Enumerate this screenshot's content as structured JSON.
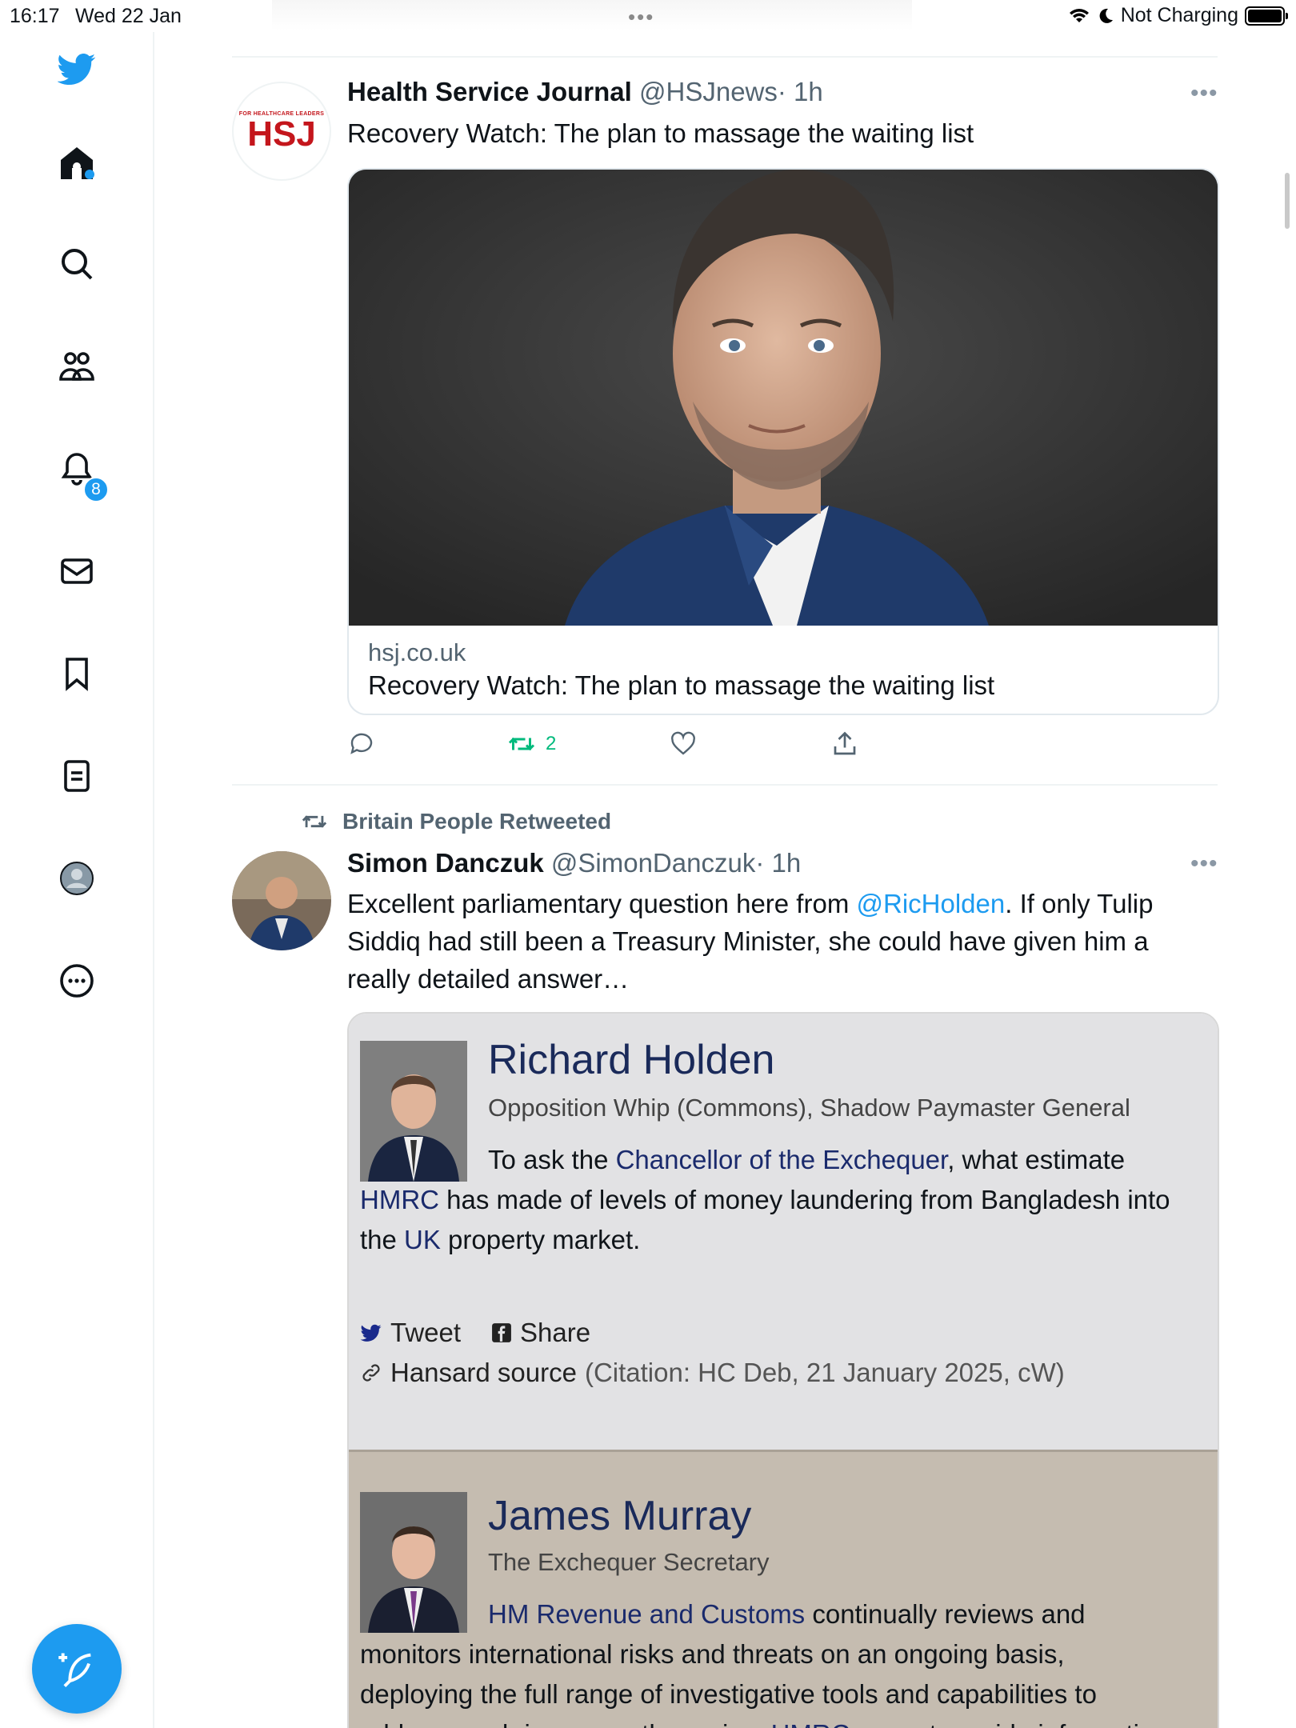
{
  "status_bar": {
    "time": "16:17",
    "date": "Wed 22 Jan",
    "battery_text": "Not Charging",
    "multitask_dots": "•••"
  },
  "sidebar": {
    "notifications_badge": "8",
    "items": [
      {
        "icon": "twitter-bird-icon"
      },
      {
        "icon": "home-icon"
      },
      {
        "icon": "search-icon"
      },
      {
        "icon": "communities-icon"
      },
      {
        "icon": "notifications-bell-icon"
      },
      {
        "icon": "messages-envelope-icon"
      },
      {
        "icon": "bookmark-icon"
      },
      {
        "icon": "lists-icon"
      },
      {
        "icon": "profile-avatar-icon"
      },
      {
        "icon": "more-options-icon"
      }
    ]
  },
  "tweet1": {
    "avatar_small": "FOR HEALTHCARE LEADERS",
    "avatar_logo": "HSJ",
    "name": "Health Service Journal",
    "handle": "@HSJnews",
    "time": "· 1h",
    "text": "Recovery Watch: The plan to massage the waiting list",
    "card_domain": "hsj.co.uk",
    "card_title": "Recovery Watch: The plan to massage the waiting list",
    "retweet_count": "2",
    "more": "•••"
  },
  "tweet2": {
    "retweeted_by": "Britain People Retweeted",
    "name": "Simon Danczuk",
    "handle": "@SimonDanczuk",
    "time": "· 1h",
    "text_part1": "Excellent parliamentary question here from ",
    "mention": "@RicHolden",
    "text_part2": ". If only Tulip",
    "text_line2": "Siddiq had still been a Treasury Minister, she could have given him a",
    "text_line3": "really detailed answer…",
    "more": "•••"
  },
  "embed": {
    "q_name": "Richard Holden",
    "q_role": "Opposition Whip (Commons), Shadow Paymaster General",
    "q_line1_a": "To ask the ",
    "q_line1_link": "Chancellor of the Exchequer",
    "q_line1_b": ", what estimate",
    "q_line2_link": "HMRC",
    "q_line2_b": " has made of levels of money laundering from Bangladesh into",
    "q_line3_a": "the ",
    "q_line3_link": "UK",
    "q_line3_b": " property market.",
    "tweet_label": "Tweet",
    "share_label": "Share",
    "hansard_label": "Hansard source",
    "citation": "(Citation: HC Deb, 21 January 2025, cW)",
    "a_name": "James Murray",
    "a_role": "The Exchequer Secretary",
    "a_line1_link": "HM Revenue and Customs",
    "a_line1_b": " continually reviews and",
    "a_line2": "monitors international risks and threats on an ongoing basis,",
    "a_line3": "deploying the full range of investigative tools and capabilities to",
    "a_line4_a": "address such issues as they arise. ",
    "a_line4_link": "HMRC",
    "a_line4_b": " cannot provide information"
  },
  "colors": {
    "accent": "#1d9bf0",
    "retweet_green": "#00ba7c",
    "hsj_red": "#c4161c",
    "hansard_link": "#1a2a6c"
  }
}
